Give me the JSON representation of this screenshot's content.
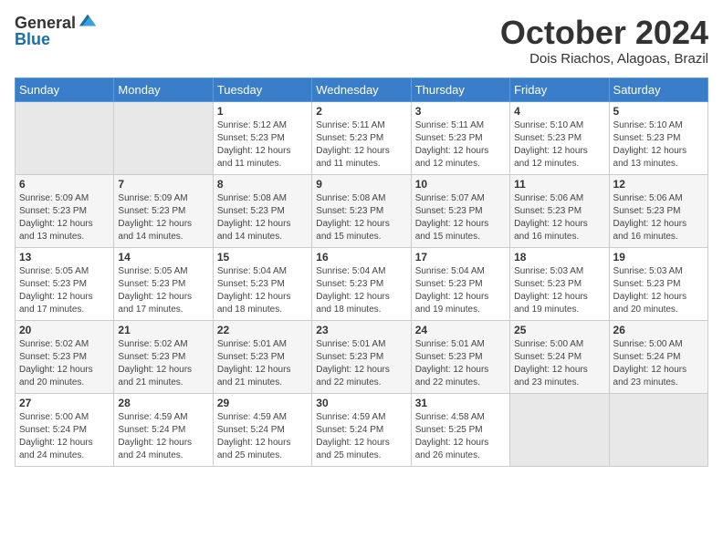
{
  "header": {
    "logo": {
      "text_general": "General",
      "text_blue": "Blue"
    },
    "month": "October 2024",
    "location": "Dois Riachos, Alagoas, Brazil"
  },
  "weekdays": [
    "Sunday",
    "Monday",
    "Tuesday",
    "Wednesday",
    "Thursday",
    "Friday",
    "Saturday"
  ],
  "weeks": [
    [
      {
        "day": "",
        "empty": true
      },
      {
        "day": "",
        "empty": true
      },
      {
        "day": "1",
        "sunrise": "Sunrise: 5:12 AM",
        "sunset": "Sunset: 5:23 PM",
        "daylight": "Daylight: 12 hours and 11 minutes."
      },
      {
        "day": "2",
        "sunrise": "Sunrise: 5:11 AM",
        "sunset": "Sunset: 5:23 PM",
        "daylight": "Daylight: 12 hours and 11 minutes."
      },
      {
        "day": "3",
        "sunrise": "Sunrise: 5:11 AM",
        "sunset": "Sunset: 5:23 PM",
        "daylight": "Daylight: 12 hours and 12 minutes."
      },
      {
        "day": "4",
        "sunrise": "Sunrise: 5:10 AM",
        "sunset": "Sunset: 5:23 PM",
        "daylight": "Daylight: 12 hours and 12 minutes."
      },
      {
        "day": "5",
        "sunrise": "Sunrise: 5:10 AM",
        "sunset": "Sunset: 5:23 PM",
        "daylight": "Daylight: 12 hours and 13 minutes."
      }
    ],
    [
      {
        "day": "6",
        "sunrise": "Sunrise: 5:09 AM",
        "sunset": "Sunset: 5:23 PM",
        "daylight": "Daylight: 12 hours and 13 minutes."
      },
      {
        "day": "7",
        "sunrise": "Sunrise: 5:09 AM",
        "sunset": "Sunset: 5:23 PM",
        "daylight": "Daylight: 12 hours and 14 minutes."
      },
      {
        "day": "8",
        "sunrise": "Sunrise: 5:08 AM",
        "sunset": "Sunset: 5:23 PM",
        "daylight": "Daylight: 12 hours and 14 minutes."
      },
      {
        "day": "9",
        "sunrise": "Sunrise: 5:08 AM",
        "sunset": "Sunset: 5:23 PM",
        "daylight": "Daylight: 12 hours and 15 minutes."
      },
      {
        "day": "10",
        "sunrise": "Sunrise: 5:07 AM",
        "sunset": "Sunset: 5:23 PM",
        "daylight": "Daylight: 12 hours and 15 minutes."
      },
      {
        "day": "11",
        "sunrise": "Sunrise: 5:06 AM",
        "sunset": "Sunset: 5:23 PM",
        "daylight": "Daylight: 12 hours and 16 minutes."
      },
      {
        "day": "12",
        "sunrise": "Sunrise: 5:06 AM",
        "sunset": "Sunset: 5:23 PM",
        "daylight": "Daylight: 12 hours and 16 minutes."
      }
    ],
    [
      {
        "day": "13",
        "sunrise": "Sunrise: 5:05 AM",
        "sunset": "Sunset: 5:23 PM",
        "daylight": "Daylight: 12 hours and 17 minutes."
      },
      {
        "day": "14",
        "sunrise": "Sunrise: 5:05 AM",
        "sunset": "Sunset: 5:23 PM",
        "daylight": "Daylight: 12 hours and 17 minutes."
      },
      {
        "day": "15",
        "sunrise": "Sunrise: 5:04 AM",
        "sunset": "Sunset: 5:23 PM",
        "daylight": "Daylight: 12 hours and 18 minutes."
      },
      {
        "day": "16",
        "sunrise": "Sunrise: 5:04 AM",
        "sunset": "Sunset: 5:23 PM",
        "daylight": "Daylight: 12 hours and 18 minutes."
      },
      {
        "day": "17",
        "sunrise": "Sunrise: 5:04 AM",
        "sunset": "Sunset: 5:23 PM",
        "daylight": "Daylight: 12 hours and 19 minutes."
      },
      {
        "day": "18",
        "sunrise": "Sunrise: 5:03 AM",
        "sunset": "Sunset: 5:23 PM",
        "daylight": "Daylight: 12 hours and 19 minutes."
      },
      {
        "day": "19",
        "sunrise": "Sunrise: 5:03 AM",
        "sunset": "Sunset: 5:23 PM",
        "daylight": "Daylight: 12 hours and 20 minutes."
      }
    ],
    [
      {
        "day": "20",
        "sunrise": "Sunrise: 5:02 AM",
        "sunset": "Sunset: 5:23 PM",
        "daylight": "Daylight: 12 hours and 20 minutes."
      },
      {
        "day": "21",
        "sunrise": "Sunrise: 5:02 AM",
        "sunset": "Sunset: 5:23 PM",
        "daylight": "Daylight: 12 hours and 21 minutes."
      },
      {
        "day": "22",
        "sunrise": "Sunrise: 5:01 AM",
        "sunset": "Sunset: 5:23 PM",
        "daylight": "Daylight: 12 hours and 21 minutes."
      },
      {
        "day": "23",
        "sunrise": "Sunrise: 5:01 AM",
        "sunset": "Sunset: 5:23 PM",
        "daylight": "Daylight: 12 hours and 22 minutes."
      },
      {
        "day": "24",
        "sunrise": "Sunrise: 5:01 AM",
        "sunset": "Sunset: 5:23 PM",
        "daylight": "Daylight: 12 hours and 22 minutes."
      },
      {
        "day": "25",
        "sunrise": "Sunrise: 5:00 AM",
        "sunset": "Sunset: 5:24 PM",
        "daylight": "Daylight: 12 hours and 23 minutes."
      },
      {
        "day": "26",
        "sunrise": "Sunrise: 5:00 AM",
        "sunset": "Sunset: 5:24 PM",
        "daylight": "Daylight: 12 hours and 23 minutes."
      }
    ],
    [
      {
        "day": "27",
        "sunrise": "Sunrise: 5:00 AM",
        "sunset": "Sunset: 5:24 PM",
        "daylight": "Daylight: 12 hours and 24 minutes."
      },
      {
        "day": "28",
        "sunrise": "Sunrise: 4:59 AM",
        "sunset": "Sunset: 5:24 PM",
        "daylight": "Daylight: 12 hours and 24 minutes."
      },
      {
        "day": "29",
        "sunrise": "Sunrise: 4:59 AM",
        "sunset": "Sunset: 5:24 PM",
        "daylight": "Daylight: 12 hours and 25 minutes."
      },
      {
        "day": "30",
        "sunrise": "Sunrise: 4:59 AM",
        "sunset": "Sunset: 5:24 PM",
        "daylight": "Daylight: 12 hours and 25 minutes."
      },
      {
        "day": "31",
        "sunrise": "Sunrise: 4:58 AM",
        "sunset": "Sunset: 5:25 PM",
        "daylight": "Daylight: 12 hours and 26 minutes."
      },
      {
        "day": "",
        "empty": true
      },
      {
        "day": "",
        "empty": true
      }
    ]
  ]
}
